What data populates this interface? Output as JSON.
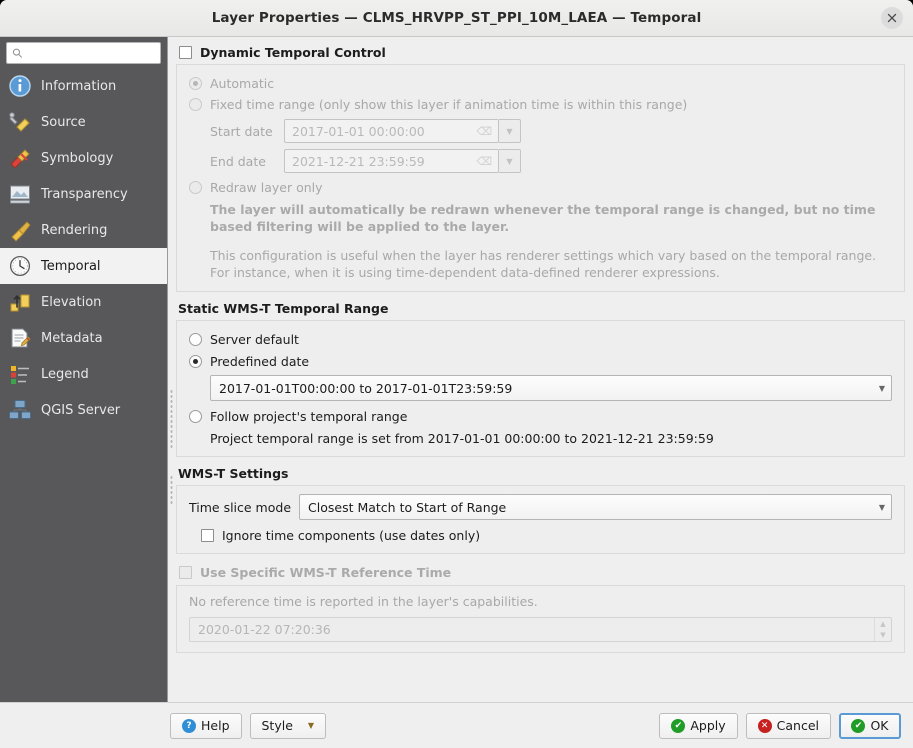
{
  "window": {
    "title": "Layer Properties — CLMS_HRVPP_ST_PPI_10M_LAEA — Temporal",
    "close_label": "✕"
  },
  "sidebar": {
    "search_placeholder": "",
    "search_value": "",
    "items": [
      {
        "label": "Information",
        "icon": "information-icon",
        "active": false
      },
      {
        "label": "Source",
        "icon": "source-icon",
        "active": false
      },
      {
        "label": "Symbology",
        "icon": "symbology-icon",
        "active": false
      },
      {
        "label": "Transparency",
        "icon": "transparency-icon",
        "active": false
      },
      {
        "label": "Rendering",
        "icon": "rendering-icon",
        "active": false
      },
      {
        "label": "Temporal",
        "icon": "clock-icon",
        "active": true
      },
      {
        "label": "Elevation",
        "icon": "elevation-icon",
        "active": false
      },
      {
        "label": "Metadata",
        "icon": "metadata-icon",
        "active": false
      },
      {
        "label": "Legend",
        "icon": "legend-icon",
        "active": false
      },
      {
        "label": "QGIS Server",
        "icon": "qgis-server-icon",
        "active": false
      }
    ]
  },
  "dynamic_temporal": {
    "checkbox_label": "Dynamic Temporal Control",
    "checked": false,
    "automatic_label": "Automatic",
    "automatic_selected": true,
    "fixed_range_label": "Fixed time range (only show this layer if animation time is within this range)",
    "fixed_range_selected": false,
    "start_date_label": "Start date",
    "start_date_value": "2017-01-01 00:00:00",
    "end_date_label": "End date",
    "end_date_value": "2021-12-21 23:59:59",
    "redraw_label": "Redraw layer only",
    "redraw_selected": false,
    "redraw_note_bold": "The layer will automatically be redrawn whenever the temporal range is changed, but no time based filtering will be applied to the layer.",
    "redraw_note": "This configuration is useful when the layer has renderer settings which vary based on the temporal range. For instance, when it is using time-dependent data-defined renderer expressions."
  },
  "static_range": {
    "title": "Static WMS-T Temporal Range",
    "server_default_label": "Server default",
    "server_default_selected": false,
    "predefined_label": "Predefined date",
    "predefined_selected": true,
    "predefined_value": "2017-01-01T00:00:00 to 2017-01-01T23:59:59",
    "follow_project_label": "Follow project's temporal range",
    "follow_project_selected": false,
    "project_range_note": "Project temporal range is set from 2017-01-01 00:00:00 to 2021-12-21 23:59:59"
  },
  "wmst_settings": {
    "title": "WMS-T Settings",
    "time_slice_label": "Time slice mode",
    "time_slice_value": "Closest Match to Start of Range",
    "ignore_time_label": "Ignore time components (use dates only)",
    "ignore_time_checked": false
  },
  "reference_time": {
    "checkbox_label": "Use Specific WMS-T Reference Time",
    "checked": false,
    "note": "No reference time is reported in the layer's capabilities.",
    "value": "2020-01-22 07:20:36"
  },
  "buttons": {
    "help": "Help",
    "style": "Style",
    "apply": "Apply",
    "cancel": "Cancel",
    "ok": "OK"
  },
  "colors": {
    "accent_blue": "#5b9bd5",
    "ok_green": "#1f9d28",
    "cancel_red": "#c62020",
    "sidebar_bg": "#58585a",
    "content_bg": "#efefef"
  }
}
